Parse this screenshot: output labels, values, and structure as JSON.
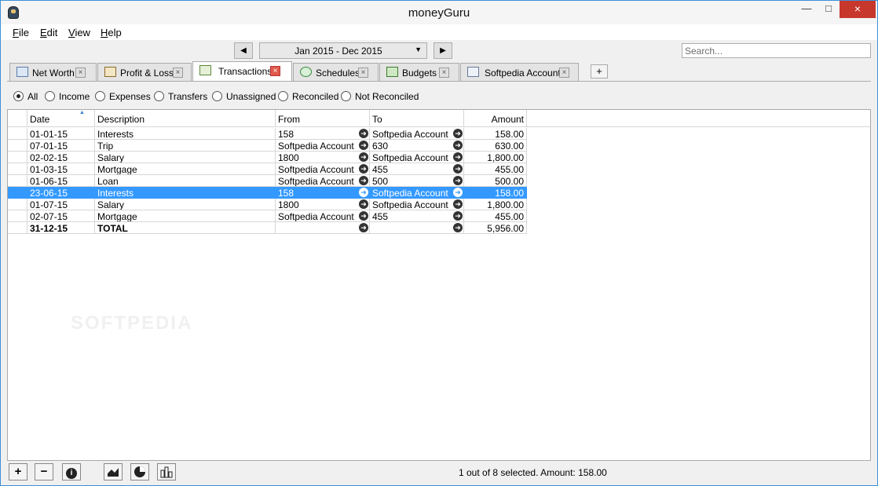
{
  "window": {
    "title": "moneyGuru",
    "close_icon": "×"
  },
  "menu": [
    {
      "accel": "F",
      "rest": "ile"
    },
    {
      "accel": "E",
      "rest": "dit"
    },
    {
      "accel": "V",
      "rest": "iew"
    },
    {
      "accel": "H",
      "rest": "elp"
    }
  ],
  "toolbar": {
    "prev_icon": "◀",
    "next_icon": "▶",
    "date_range": "Jan 2015 - Dec 2015",
    "dropdown_icon": "▼",
    "search_placeholder": "Search..."
  },
  "tabs": [
    {
      "label": "Net Worth",
      "icon": "net-worth-chart-icon"
    },
    {
      "label": "Profit & Loss",
      "icon": "profit-loss-chart-icon"
    },
    {
      "label": "Transactions",
      "icon": "transactions-icon",
      "active": true
    },
    {
      "label": "Schedules",
      "icon": "schedules-icon"
    },
    {
      "label": "Budgets",
      "icon": "budgets-icon"
    },
    {
      "label": "Softpedia Account",
      "icon": "account-icon"
    }
  ],
  "tab_close": "×",
  "add_tab_label": "+",
  "filters": [
    "All",
    "Income",
    "Expenses",
    "Transfers",
    "Unassigned",
    "Reconciled",
    "Not Reconciled"
  ],
  "selected_filter": "All",
  "columns": {
    "date": "Date",
    "description": "Description",
    "from": "From",
    "to": "To",
    "amount": "Amount"
  },
  "sort_indicator": "▲",
  "rows": [
    {
      "date": "01-01-15",
      "description": "Interests",
      "from": "158",
      "to": "Softpedia Account",
      "amount": "158.00"
    },
    {
      "date": "07-01-15",
      "description": "Trip",
      "from": "Softpedia Account",
      "to": "630",
      "amount": "630.00"
    },
    {
      "date": "02-02-15",
      "description": "Salary",
      "from": "1800",
      "to": "Softpedia Account",
      "amount": "1,800.00"
    },
    {
      "date": "01-03-15",
      "description": "Mortgage",
      "from": "Softpedia Account",
      "to": "455",
      "amount": "455.00"
    },
    {
      "date": "01-06-15",
      "description": "Loan",
      "from": "Softpedia Account",
      "to": "500",
      "amount": "500.00"
    },
    {
      "date": "23-06-15",
      "description": "Interests",
      "from": "158",
      "to": "Softpedia Account",
      "amount": "158.00"
    },
    {
      "date": "01-07-15",
      "description": "Salary",
      "from": "1800",
      "to": "Softpedia Account",
      "amount": "1,800.00"
    },
    {
      "date": "02-07-15",
      "description": "Mortgage",
      "from": "Softpedia Account",
      "to": "455",
      "amount": "455.00"
    }
  ],
  "selected_row": 5,
  "total_row": {
    "date": "31-12-15",
    "description": "TOTAL",
    "from": "",
    "to": "",
    "amount": "5,956.00"
  },
  "go_arrow": "➜",
  "bottom": {
    "add_label": "+",
    "remove_label": "−",
    "info_label": "i",
    "status": "1 out of 8 selected. Amount: 158.00"
  },
  "watermark": "SOFTPEDIA"
}
